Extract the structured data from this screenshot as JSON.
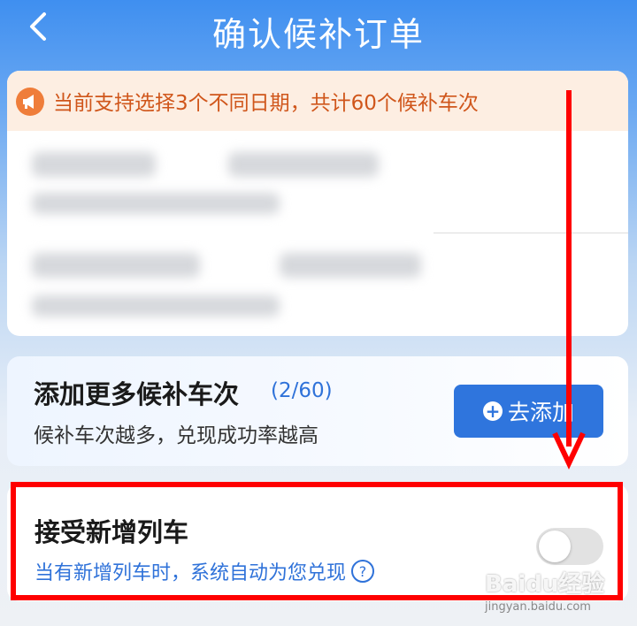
{
  "header": {
    "title": "确认候补订单",
    "back_icon": "chevron-left-icon"
  },
  "notice": {
    "icon": "megaphone-icon",
    "text": "当前支持选择3个不同日期，共计60个候补车次",
    "color": "#d0561b"
  },
  "add_more": {
    "title": "添加更多候补车次",
    "count": "(2/60)",
    "subtitle": "候补车次越多，兑现成功率越高",
    "button_label": "去添加",
    "button_icon": "plus-circle-icon"
  },
  "accept_new_trains": {
    "title": "接受新增列车",
    "subtitle": "当有新增列车时，系统自动为您兑现",
    "help_icon": "question-circle-icon",
    "toggle_on": false
  },
  "watermark": {
    "main": "Baidu经验",
    "sub": "jingyan.baidu.com"
  },
  "colors": {
    "accent": "#2f75dd",
    "annotation": "#ff0000"
  }
}
